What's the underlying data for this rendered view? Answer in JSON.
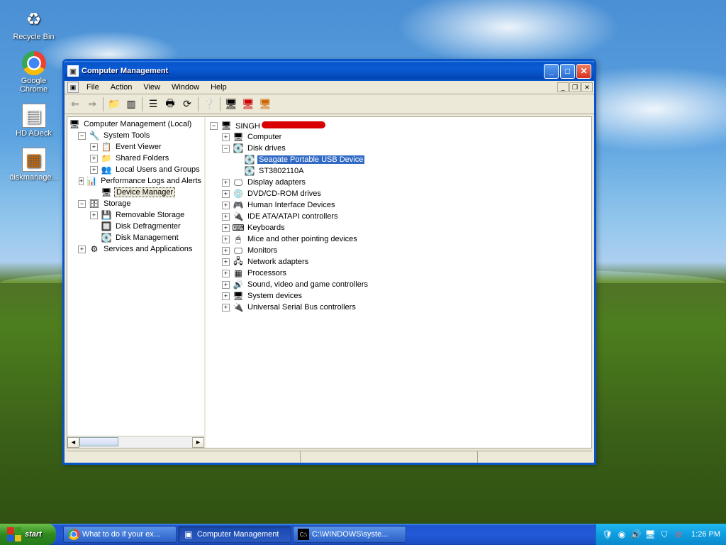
{
  "desktop_icons": [
    {
      "name": "recycle-bin",
      "label": "Recycle Bin",
      "glyph": "♻"
    },
    {
      "name": "google-chrome",
      "label": "Google Chrome",
      "glyph": "◉"
    },
    {
      "name": "hd-adeck",
      "label": "HD ADeck",
      "glyph": "▤"
    },
    {
      "name": "diskmanage",
      "label": "diskmanage...",
      "glyph": "▦"
    }
  ],
  "window": {
    "title": "Computer Management",
    "menu": [
      "File",
      "Action",
      "View",
      "Window",
      "Help"
    ],
    "toolbar_icons": [
      "back-icon",
      "forward-icon",
      "up-icon",
      "show-hide-tree-icon",
      "properties-icon",
      "print-icon",
      "refresh-icon",
      "help-icon",
      "scan-hardware-icon",
      "uninstall-icon",
      "disable-icon"
    ]
  },
  "left_tree": {
    "root": "Computer Management (Local)",
    "system_tools": "System Tools",
    "event_viewer": "Event Viewer",
    "shared_folders": "Shared Folders",
    "local_users": "Local Users and Groups",
    "perf_logs": "Performance Logs and Alerts",
    "device_manager": "Device Manager",
    "storage": "Storage",
    "removable_storage": "Removable Storage",
    "disk_defrag": "Disk Defragmenter",
    "disk_mgmt": "Disk Management",
    "services": "Services and Applications"
  },
  "right_tree": {
    "root": "SINGH",
    "computer": "Computer",
    "disk_drives": "Disk drives",
    "seagate": "Seagate Portable USB Device",
    "st_drive": "ST3802110A",
    "display": "Display adapters",
    "dvd": "DVD/CD-ROM drives",
    "hid": "Human Interface Devices",
    "ide": "IDE ATA/ATAPI controllers",
    "keyb": "Keyboards",
    "mice": "Mice and other pointing devices",
    "mon": "Monitors",
    "net": "Network adapters",
    "proc": "Processors",
    "sound": "Sound, video and game controllers",
    "sys": "System devices",
    "usb": "Universal Serial Bus controllers"
  },
  "taskbar": {
    "start": "start",
    "items": [
      {
        "label": "What to do if your ex...",
        "icon": "◉"
      },
      {
        "label": "Computer Management",
        "icon": "▣"
      },
      {
        "label": "C:\\WINDOWS\\syste...",
        "icon": "▪"
      }
    ],
    "clock": "1:26 PM"
  }
}
